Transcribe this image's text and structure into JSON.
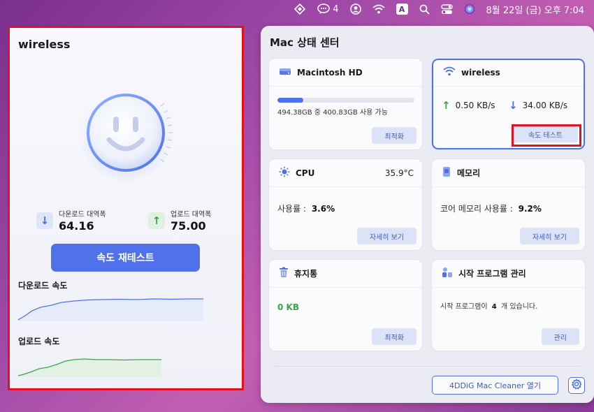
{
  "menubar": {
    "notifications_count": "4",
    "input_indicator": "A",
    "datetime": "8월 22일 (금) 오후  7:04"
  },
  "left_panel": {
    "title": "wireless",
    "download_bandwidth_label": "다운로드 대역폭",
    "download_bandwidth_value": "64.16",
    "upload_bandwidth_label": "업로드 대역폭",
    "upload_bandwidth_value": "75.00",
    "retest_label": "속도 재테스트",
    "download_speed_label": "다운로드 속도",
    "upload_speed_label": "업로드 속도"
  },
  "window": {
    "title": "Mac 상태 센터",
    "disk": {
      "title": "Macintosh HD",
      "usage_text": "494.38GB 중 400.83GB 사용 가능",
      "usage_fraction": 0.19,
      "button": "최적화"
    },
    "network": {
      "title": "wireless",
      "upload_speed": "0.50 KB/s",
      "download_speed": "34.00 KB/s",
      "button": "속도 테스트"
    },
    "cpu": {
      "title": "CPU",
      "temperature": "35.9°C",
      "usage_label": "사용률 :",
      "usage_value": "3.6%",
      "button": "자세히 보기"
    },
    "memory": {
      "title": "메모리",
      "usage_label": "코어 메모리 사용률 :",
      "usage_value": "9.2%",
      "button": "자세히 보기"
    },
    "trash": {
      "title": "휴지통",
      "value": "0  KB",
      "button": "최적화"
    },
    "startup": {
      "title": "시작 프로그램 관리",
      "text_before": "시작 프로그램이",
      "count": "4",
      "text_after": "개 있습니다.",
      "button": "관리"
    },
    "footer_button": "4DDiG Mac Cleaner 열기"
  },
  "colors": {
    "accent": "#4f72ea",
    "highlight_red": "#e0121f",
    "upload_green": "#3aa64a"
  }
}
